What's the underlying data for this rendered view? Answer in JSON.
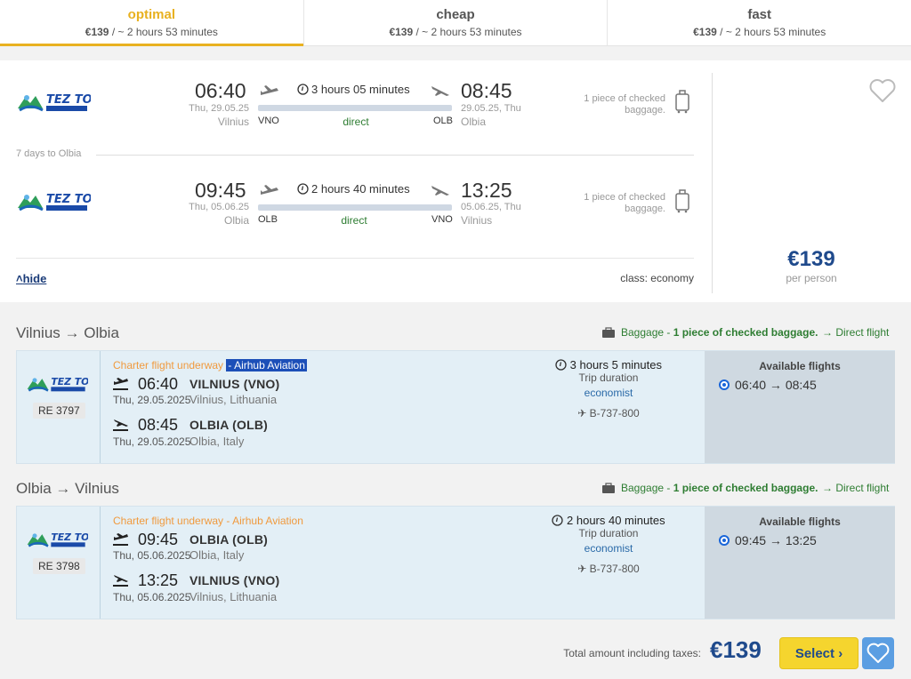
{
  "tabs": [
    {
      "title": "optimal",
      "price": "€139",
      "sub": " / ~ 2 hours 53 minutes"
    },
    {
      "title": "cheap",
      "price": "€139",
      "sub": " / ~ 2 hours 53 minutes"
    },
    {
      "title": "fast",
      "price": "€139",
      "sub": " / ~ 2 hours 53 minutes"
    }
  ],
  "summary": {
    "outbound": {
      "dep_time": "06:40",
      "dep_date": "Thu, 29.05.25",
      "dep_city": "Vilnius",
      "dep_code": "VNO",
      "duration": "3 hours 05 minutes",
      "direct": "direct",
      "arr_time": "08:45",
      "arr_date": "29.05.25, Thu",
      "arr_city": "Olbia",
      "arr_code": "OLB",
      "baggage": [
        "1 piece of checked",
        "baggage."
      ]
    },
    "stay": "7 days to Olbia",
    "inbound": {
      "dep_time": "09:45",
      "dep_date": "Thu, 05.06.25",
      "dep_city": "Olbia",
      "dep_code": "OLB",
      "duration": "2 hours 40 minutes",
      "direct": "direct",
      "arr_time": "13:25",
      "arr_date": "05.06.25, Thu",
      "arr_city": "Vilnius",
      "arr_code": "VNO",
      "baggage": [
        "1 piece of checked",
        "baggage."
      ]
    },
    "hide": "hide",
    "class": "class: economy",
    "price": "€139",
    "per_person": "per person"
  },
  "segments": [
    {
      "route": "Vilnius → Olbia",
      "baggage_prefix": "Baggage - ",
      "baggage_bold": "1 piece of checked baggage.",
      "direct_flight": "→ Direct flight",
      "flight_no": "RE 3797",
      "charter_prefix": "Charter flight underway ",
      "charter_airline": "- Airhub Aviation",
      "dep_time": "06:40",
      "dep_airport": "VILNIUS (VNO)",
      "dep_date": "Thu, 29.05.2025",
      "dep_place": "Vilnius, Lithuania",
      "arr_time": "08:45",
      "arr_airport": "OLBIA (OLB)",
      "arr_date": "Thu, 29.05.2025",
      "arr_place": "Olbia, Italy",
      "trip_duration": "3 hours 5 minutes",
      "trip_label": "Trip duration",
      "cabin": "economist",
      "aircraft": "✈ B-737-800",
      "avail_title": "Available flights",
      "avail_option": "06:40 → 08:45"
    },
    {
      "route": "Olbia → Vilnius",
      "baggage_prefix": "Baggage - ",
      "baggage_bold": "1 piece of checked baggage.",
      "direct_flight": "→ Direct flight",
      "flight_no": "RE 3798",
      "charter_prefix": "Charter flight underway ",
      "charter_airline": "- Airhub Aviation",
      "dep_time": "09:45",
      "dep_airport": "OLBIA (OLB)",
      "dep_date": "Thu, 05.06.2025",
      "dep_place": "Olbia, Italy",
      "arr_time": "13:25",
      "arr_airport": "VILNIUS (VNO)",
      "arr_date": "Thu, 05.06.2025",
      "arr_place": "Vilnius, Lithuania",
      "trip_duration": "2 hours 40 minutes",
      "trip_label": "Trip duration",
      "cabin": "economist",
      "aircraft": "✈ B-737-800",
      "avail_title": "Available flights",
      "avail_option": "09:45 → 13:25"
    }
  ],
  "footer": {
    "total_label": "Total amount including taxes:",
    "total": "€139",
    "select": "Select"
  },
  "colors": {
    "accent": "#e8b120",
    "price": "#1f4a8c",
    "green": "#2e7d32",
    "charter": "#f09a3e",
    "select": "#f5d52e",
    "fav": "#5b9ee2"
  },
  "logo_label": "TEZ TOUR"
}
